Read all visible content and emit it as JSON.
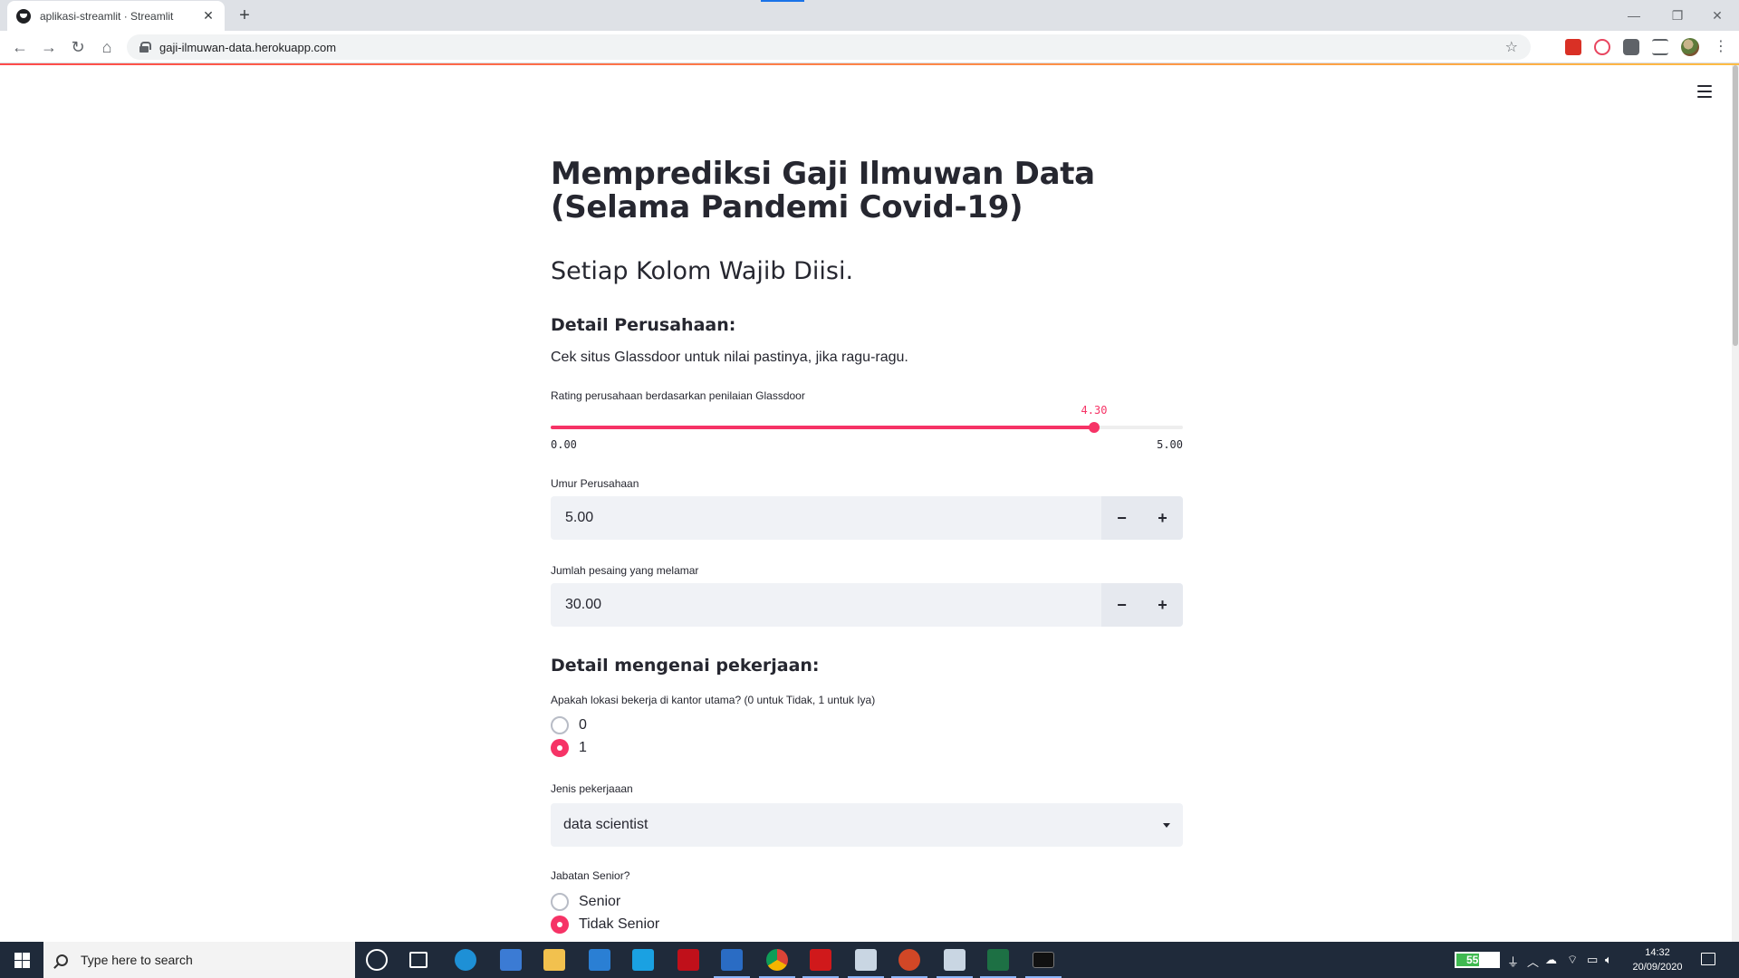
{
  "browser": {
    "tab_title": "aplikasi-streamlit · Streamlit",
    "url": "gaji-ilmuwan-data.herokuapp.com",
    "new_tab_symbol": "+",
    "close_symbol": "✕"
  },
  "app": {
    "title": "Memprediksi Gaji Ilmuwan Data (Selama Pandemi Covid-19)",
    "subtitle": "Setiap Kolom Wajib Diisi.",
    "company_section": {
      "heading": "Detail Perusahaan:",
      "description": "Cek situs Glassdoor untuk nilai pastinya, jika ragu-ragu.",
      "rating_slider": {
        "label": "Rating perusahaan berdasarkan penilaian Glassdoor",
        "value": 4.3,
        "value_text": "4.30",
        "min": 0,
        "max": 5,
        "min_text": "0.00",
        "max_text": "5.00",
        "accent_color": "#f63366"
      },
      "company_age": {
        "label": "Umur Perusahaan",
        "value": "5.00",
        "minus": "−",
        "plus": "+"
      },
      "competitors": {
        "label": "Jumlah pesaing yang melamar",
        "value": "30.00",
        "minus": "−",
        "plus": "+"
      }
    },
    "job_section": {
      "heading": "Detail mengenai pekerjaan:",
      "headquarters": {
        "label": "Apakah lokasi bekerja di kantor utama? (0 untuk Tidak, 1 untuk Iya)",
        "options": [
          "0",
          "1"
        ],
        "selected": "1"
      },
      "job_type": {
        "label": "Jenis pekerjaaan",
        "value": "data scientist"
      },
      "seniority": {
        "label": "Jabatan Senior?",
        "options": [
          "Senior",
          "Tidak Senior"
        ],
        "selected": "Tidak Senior"
      }
    }
  },
  "taskbar": {
    "search_placeholder": "Type here to search",
    "battery_percent": 55,
    "battery_text": "55%",
    "time": "14:32",
    "date": "20/09/2020"
  }
}
